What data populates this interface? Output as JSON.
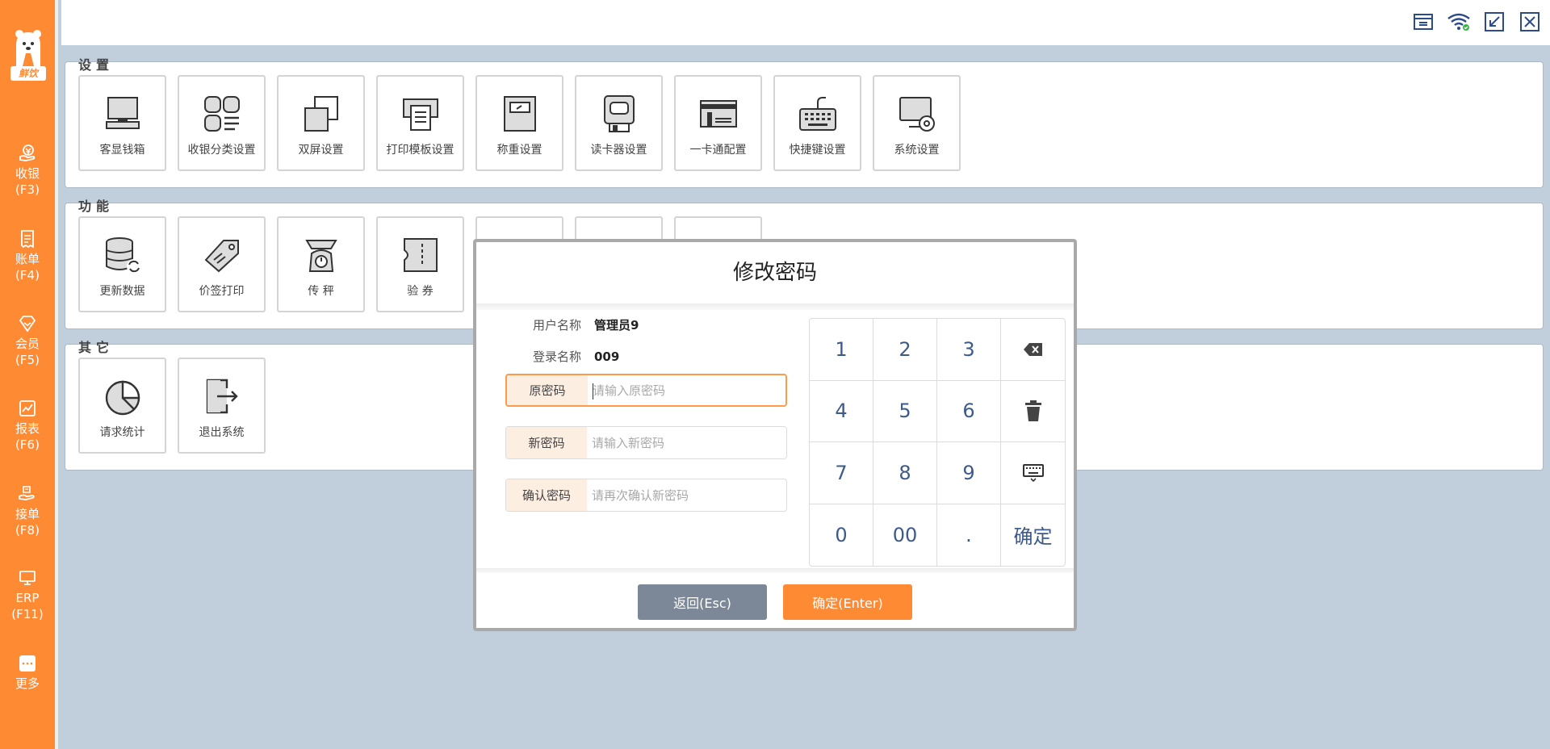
{
  "sidebar": {
    "logo_text": "鲜饮",
    "items": [
      {
        "label": "收银",
        "key": "(F3)"
      },
      {
        "label": "账单",
        "key": "(F4)"
      },
      {
        "label": "会员",
        "key": "(F5)"
      },
      {
        "label": "报表",
        "key": "(F6)"
      },
      {
        "label": "接单",
        "key": "(F8)"
      },
      {
        "label": "ERP",
        "key": "(F11)"
      },
      {
        "label": "更多",
        "key": ""
      }
    ]
  },
  "topbar": {
    "icons": [
      "window-icon",
      "wifi-icon",
      "minimize-icon",
      "close-icon"
    ]
  },
  "sections": {
    "settings": {
      "title": "设置",
      "tiles": [
        "客显钱箱",
        "收银分类设置",
        "双屏设置",
        "打印模板设置",
        "称重设置",
        "读卡器设置",
        "一卡通配置",
        "快捷键设置",
        "系统设置"
      ]
    },
    "functions": {
      "title": "功能",
      "tiles": [
        "更新数据",
        "价签打印",
        "传 秤",
        "验 券"
      ]
    },
    "others": {
      "title": "其它",
      "tiles": [
        "请求统计",
        "退出系统"
      ]
    }
  },
  "modal": {
    "title": "修改密码",
    "username_label": "用户名称",
    "username_value": "管理员9",
    "login_label": "登录名称",
    "login_value": "009",
    "old_pw_label": "原密码",
    "old_pw_placeholder": "请输入原密码",
    "new_pw_label": "新密码",
    "new_pw_placeholder": "请输入新密码",
    "confirm_pw_label": "确认密码",
    "confirm_pw_placeholder": "请再次确认新密码",
    "keys": [
      "1",
      "2",
      "3",
      "backspace",
      "4",
      "5",
      "6",
      "trash",
      "7",
      "8",
      "9",
      "keyboard",
      "0",
      "00",
      ".",
      "确定"
    ],
    "back_label": "返回(Esc)",
    "ok_label": "确定(Enter)"
  },
  "colors": {
    "accent": "#ff8a34",
    "background": "#c1cedc",
    "keypad_text": "#3d5a8c",
    "back_button": "#7c8798"
  }
}
